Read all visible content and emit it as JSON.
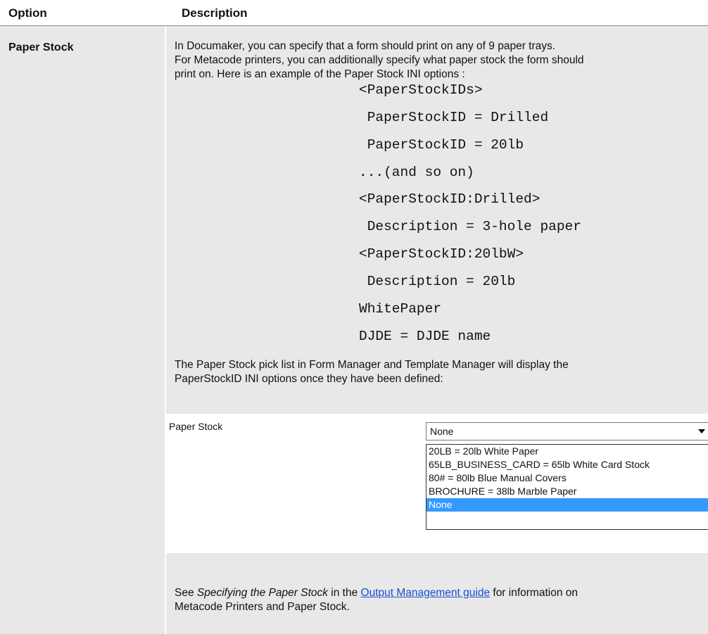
{
  "header": {
    "option_label": "Option",
    "description_label": "Description"
  },
  "row": {
    "option_name": "Paper Stock",
    "intro_line1": "In Documaker, you can specify that a form should print on any of 9 paper trays.",
    "intro_line2": "For Metacode printers, you can additionally specify what paper stock the form should",
    "intro_line3": "print on. Here is an example of the Paper Stock INI options :",
    "code_lines": [
      "<PaperStockIDs>",
      " PaperStockID = Drilled",
      " PaperStockID = 20lb",
      "...(and so on)",
      "<PaperStockID:Drilled>",
      " Description = 3-hole paper",
      "<PaperStockID:20lbW>",
      " Description = 20lb",
      "WhitePaper",
      "DJDE = DJDE name"
    ],
    "pick_list_line1": "The Paper Stock pick list in Form Manager and Template Manager will display the",
    "pick_list_line2": "PaperStockID INI options once they have been defined:",
    "screenshot": {
      "field_label": "Paper Stock",
      "selected_value": "None",
      "options": [
        "20LB = 20lb White Paper",
        "65LB_BUSINESS_CARD = 65lb White Card Stock",
        "80# = 80lb Blue Manual Covers",
        "BROCHURE = 38lb Marble Paper",
        "None"
      ],
      "highlighted_option": "None"
    },
    "see_prefix": "See ",
    "see_italic": "Specifying the Paper Stock",
    "see_middle": " in the ",
    "see_link": "Output Management guide",
    "see_suffix_line1": " for information on",
    "see_line2": "Metacode Printers and Paper Stock."
  }
}
